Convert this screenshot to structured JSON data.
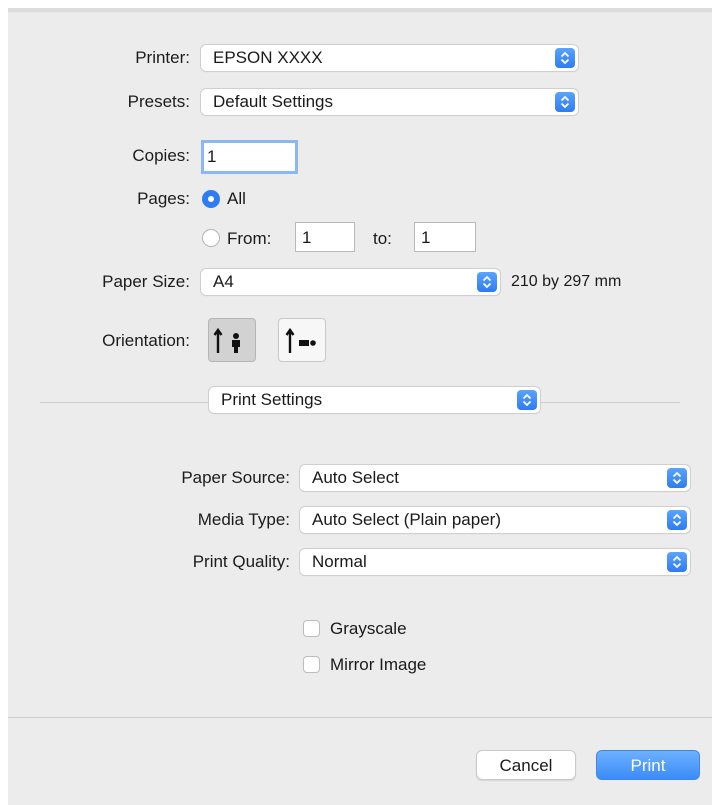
{
  "printer": {
    "label": "Printer:",
    "value": "EPSON XXXX"
  },
  "presets": {
    "label": "Presets:",
    "value": "Default Settings"
  },
  "copies": {
    "label": "Copies:",
    "value": "1"
  },
  "pages": {
    "label": "Pages:",
    "all_label": "All",
    "from_label": "From:",
    "from_value": "1",
    "to_label": "to:",
    "to_value": "1",
    "selected": "All"
  },
  "paper_size": {
    "label": "Paper Size:",
    "value": "A4",
    "dimensions": "210 by 297 mm"
  },
  "orientation": {
    "label": "Orientation:",
    "selected": "portrait"
  },
  "section_menu": {
    "value": "Print Settings"
  },
  "paper_source": {
    "label": "Paper Source:",
    "value": "Auto Select"
  },
  "media_type": {
    "label": "Media Type:",
    "value": "Auto Select (Plain paper)"
  },
  "print_quality": {
    "label": "Print Quality:",
    "value": "Normal"
  },
  "grayscale": {
    "label": "Grayscale",
    "checked": false
  },
  "mirror_image": {
    "label": "Mirror Image",
    "checked": false
  },
  "buttons": {
    "cancel": "Cancel",
    "print": "Print"
  },
  "colors": {
    "accent": "#2f7cf0",
    "panel": "#ececec"
  },
  "icons": {
    "stepper": "up-down-chevron-icon",
    "portrait": "portrait-orientation-icon",
    "landscape": "landscape-orientation-icon"
  }
}
